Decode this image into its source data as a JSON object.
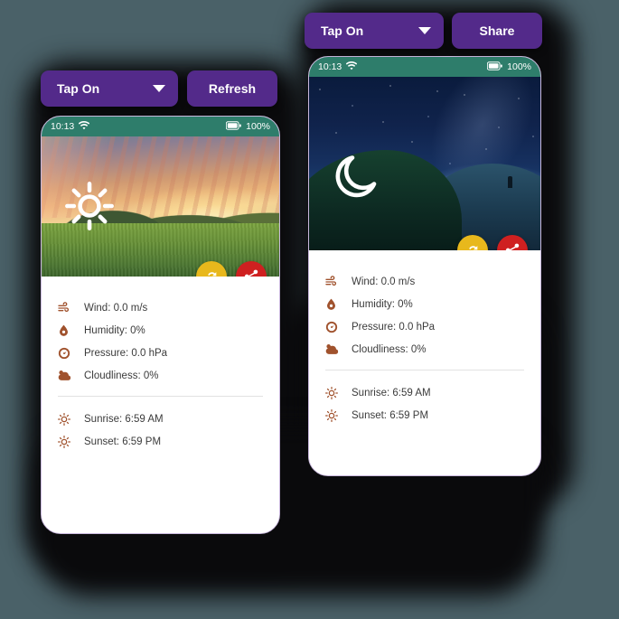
{
  "theme": {
    "page_background": "#4a6168",
    "button_purple": "#532a8a",
    "statusbar_teal": "#2e7d6b",
    "refresh_yellow": "#e8b81c",
    "share_red": "#cf2020",
    "detail_icon_brown": "#a0522d",
    "device_border": "#c9b8dd"
  },
  "controls": {
    "back_device": {
      "dropdown_label": "Tap On",
      "dropdown_icon": "chevron-down-icon",
      "action_label": "Share"
    },
    "front_device": {
      "dropdown_label": "Tap On",
      "dropdown_icon": "chevron-down-icon",
      "action_label": "Refresh"
    }
  },
  "status_bar": {
    "time": "10:13",
    "wifi_icon": "wifi-icon",
    "battery_icon": "battery-full-icon",
    "battery_level": "100%"
  },
  "devices": {
    "back": {
      "scene": "night",
      "weather_glyph": "moon-icon",
      "actions": [
        {
          "name": "refresh-fab",
          "icon": "refresh-icon"
        },
        {
          "name": "share-fab",
          "icon": "share-icon"
        }
      ],
      "details": [
        {
          "icon": "wind-icon",
          "text": "Wind: 0.0 m/s"
        },
        {
          "icon": "humidity-icon",
          "text": "Humidity: 0%"
        },
        {
          "icon": "pressure-icon",
          "text": "Pressure: 0.0 hPa"
        },
        {
          "icon": "cloud-icon",
          "text": "Cloudliness: 0%"
        }
      ],
      "sun_times": [
        {
          "icon": "sunrise-icon",
          "text": "Sunrise: 6:59 AM"
        },
        {
          "icon": "sunset-icon",
          "text": "Sunset: 6:59 PM"
        }
      ]
    },
    "front": {
      "scene": "day",
      "weather_glyph": "sun-icon",
      "actions": [
        {
          "name": "refresh-fab",
          "icon": "refresh-icon"
        },
        {
          "name": "share-fab",
          "icon": "share-icon"
        }
      ],
      "details": [
        {
          "icon": "wind-icon",
          "text": "Wind: 0.0 m/s"
        },
        {
          "icon": "humidity-icon",
          "text": "Humidity: 0%"
        },
        {
          "icon": "pressure-icon",
          "text": "Pressure: 0.0 hPa"
        },
        {
          "icon": "cloud-icon",
          "text": "Cloudliness: 0%"
        }
      ],
      "sun_times": [
        {
          "icon": "sunrise-icon",
          "text": "Sunrise: 6:59 AM"
        },
        {
          "icon": "sunset-icon",
          "text": "Sunset: 6:59 PM"
        }
      ]
    }
  }
}
